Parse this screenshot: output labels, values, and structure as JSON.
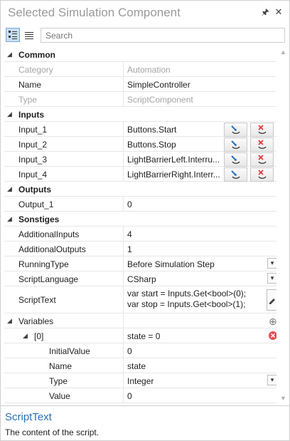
{
  "window": {
    "title": "Selected Simulation Component"
  },
  "toolbar": {
    "search_placeholder": "Search"
  },
  "categories": {
    "common": "Common",
    "inputs": "Inputs",
    "outputs": "Outputs",
    "sonstiges": "Sonstiges"
  },
  "common": {
    "category": {
      "name": "Category",
      "value": "Automation"
    },
    "name": {
      "name": "Name",
      "value": "SimpleController"
    },
    "type": {
      "name": "Type",
      "value": "ScriptComponent"
    }
  },
  "inputs": [
    {
      "name": "Input_1",
      "value": "Buttons.Start"
    },
    {
      "name": "Input_2",
      "value": "Buttons.Stop"
    },
    {
      "name": "Input_3",
      "value": "LightBarrierLeft.Interru..."
    },
    {
      "name": "Input_4",
      "value": "LightBarrierRight.Interr..."
    }
  ],
  "outputs": [
    {
      "name": "Output_1",
      "value": "0"
    }
  ],
  "sonstiges": {
    "additional_inputs": {
      "name": "AdditionalInputs",
      "value": "4"
    },
    "additional_outputs": {
      "name": "AdditionalOutputs",
      "value": "1"
    },
    "running_type": {
      "name": "RunningType",
      "value": "Before Simulation Step"
    },
    "script_language": {
      "name": "ScriptLanguage",
      "value": "CSharp"
    },
    "script_text": {
      "name": "ScriptText",
      "line1": "var start = Inputs.Get<bool>(0);",
      "line2": "var stop = Inputs.Get<bool>(1);"
    },
    "variables": {
      "name": "Variables"
    },
    "variable_0": {
      "name": "[0]",
      "value": "state = 0",
      "initial_value": {
        "name": "InitialValue",
        "value": "0"
      },
      "var_name": {
        "name": "Name",
        "value": "state"
      },
      "type": {
        "name": "Type",
        "value": "Integer"
      },
      "value_prop": {
        "name": "Value",
        "value": "0"
      }
    }
  },
  "help": {
    "title": "ScriptText",
    "description": "The content of the script."
  },
  "colors": {
    "accent": "#2a70b8",
    "delete": "#e05050",
    "add": "#7a7a7a"
  }
}
